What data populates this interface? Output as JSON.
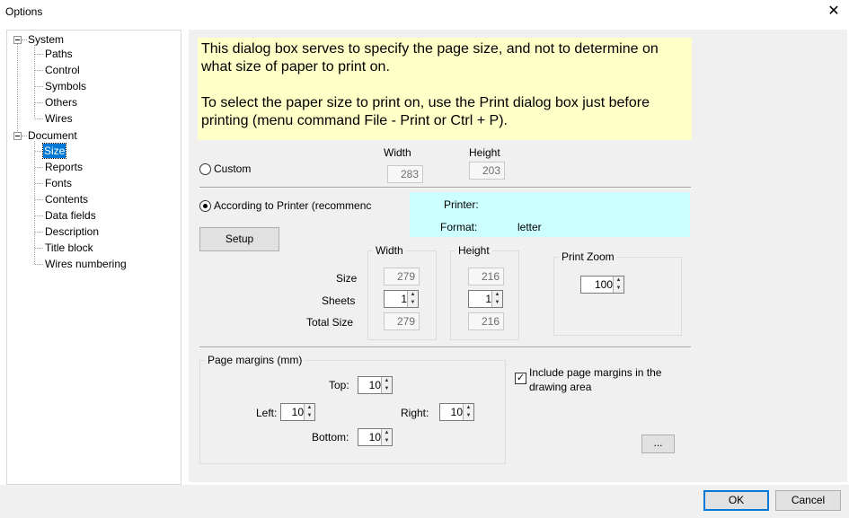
{
  "window": {
    "title": "Options",
    "close": "✕"
  },
  "tree": {
    "system": {
      "label": "System",
      "children": [
        "Paths",
        "Control",
        "Symbols",
        "Others",
        "Wires"
      ]
    },
    "document": {
      "label": "Document",
      "children": [
        "Size",
        "Reports",
        "Fonts",
        "Contents",
        "Data fields",
        "Description",
        "Title block",
        "Wires numbering"
      ]
    },
    "selected": "Size"
  },
  "note": {
    "para1": "This dialog box serves to specify the page size, and not to determine on what size of paper to print on.",
    "para2": "To select the paper size to print on, use the Print dialog box just before printing (menu command File - Print or Ctrl + P)."
  },
  "custom": {
    "label": "Custom",
    "selected": false,
    "width_label": "Width",
    "height_label": "Height",
    "width": "283",
    "height": "203"
  },
  "printer": {
    "label": "According to Printer (recommenc",
    "selected": true,
    "printer_label": "Printer:",
    "printer_value": "",
    "format_label": "Format:",
    "format_value": "letter",
    "setup": "Setup"
  },
  "sizes": {
    "width_group": "Width",
    "height_group": "Height",
    "row_labels": [
      "Size",
      "Sheets",
      "Total Size"
    ],
    "width_size": "279",
    "width_sheets": "1",
    "width_total": "279",
    "height_size": "216",
    "height_sheets": "1",
    "height_total": "216"
  },
  "zoom": {
    "label": "Print Zoom",
    "value": "100"
  },
  "margins": {
    "group": "Page margins (mm)",
    "top_label": "Top:",
    "top": "10",
    "left_label": "Left:",
    "left": "10",
    "right_label": "Right:",
    "right": "10",
    "bottom_label": "Bottom:",
    "bottom": "10"
  },
  "include": {
    "label": "Include page margins in the drawing area",
    "checked": true
  },
  "more_button": "...",
  "ok": "OK",
  "cancel": "Cancel"
}
